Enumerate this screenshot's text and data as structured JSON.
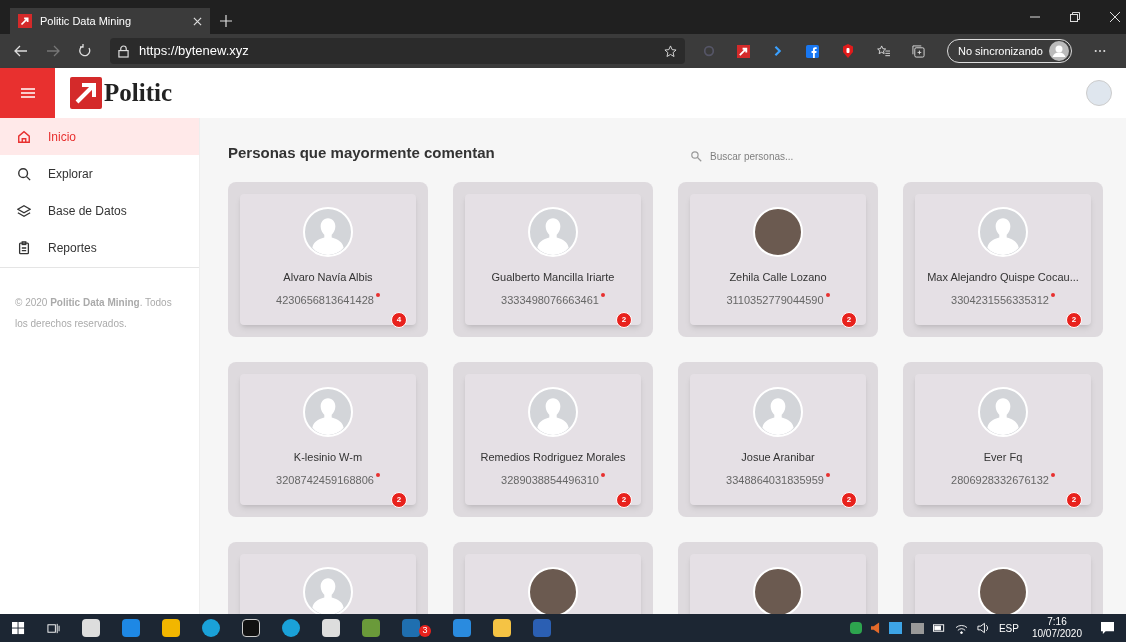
{
  "browser": {
    "tab_title": "Politic Data Mining",
    "url": "https://bytenew.xyz",
    "sync_label": "No sincronizando"
  },
  "app": {
    "logo_text": "Politic"
  },
  "sidebar": {
    "items": [
      {
        "label": "Inicio",
        "kind": "home",
        "selected": true
      },
      {
        "label": "Explorar",
        "kind": "search",
        "selected": false
      },
      {
        "label": "Base de Datos",
        "kind": "layers",
        "selected": false
      },
      {
        "label": "Reportes",
        "kind": "clipboard",
        "selected": false
      }
    ],
    "footer": "© 2020 **Politic Data Mining**. Todos los derechos reservados."
  },
  "main": {
    "heading": "Personas que mayormente comentan",
    "search": {
      "placeholder": "Buscar personas..."
    },
    "people": [
      {
        "name": "Alvaro Navía Albis",
        "id": "4230656813641428",
        "count": "4",
        "kind": "default"
      },
      {
        "name": "Gualberto Mancilla Iriarte",
        "id": "3333498076663461",
        "count": "2",
        "kind": "default"
      },
      {
        "name": "Zehila Calle Lozano",
        "id": "3110352779044590",
        "count": "2",
        "kind": "photo"
      },
      {
        "name": "Max Alejandro Quispe Cocau...",
        "id": "3304231556335312",
        "count": "2",
        "kind": "default"
      },
      {
        "name": "K-lesinio W-m",
        "id": "3208742459168806",
        "count": "2",
        "kind": "default"
      },
      {
        "name": "Remedios Rodriguez Morales",
        "id": "3289038854496310",
        "count": "2",
        "kind": "default"
      },
      {
        "name": "Josue Aranibar",
        "id": "3348864031835959",
        "count": "2",
        "kind": "default"
      },
      {
        "name": "Ever Fq",
        "id": "2806928332676132",
        "count": "2",
        "kind": "default"
      },
      {
        "kind": "default"
      },
      {
        "kind": "photo"
      },
      {
        "kind": "photo"
      },
      {
        "kind": "photo"
      }
    ]
  },
  "taskbar": {
    "badge": "3",
    "language": "ESP",
    "time": "7:16",
    "date": "10/07/2020"
  }
}
